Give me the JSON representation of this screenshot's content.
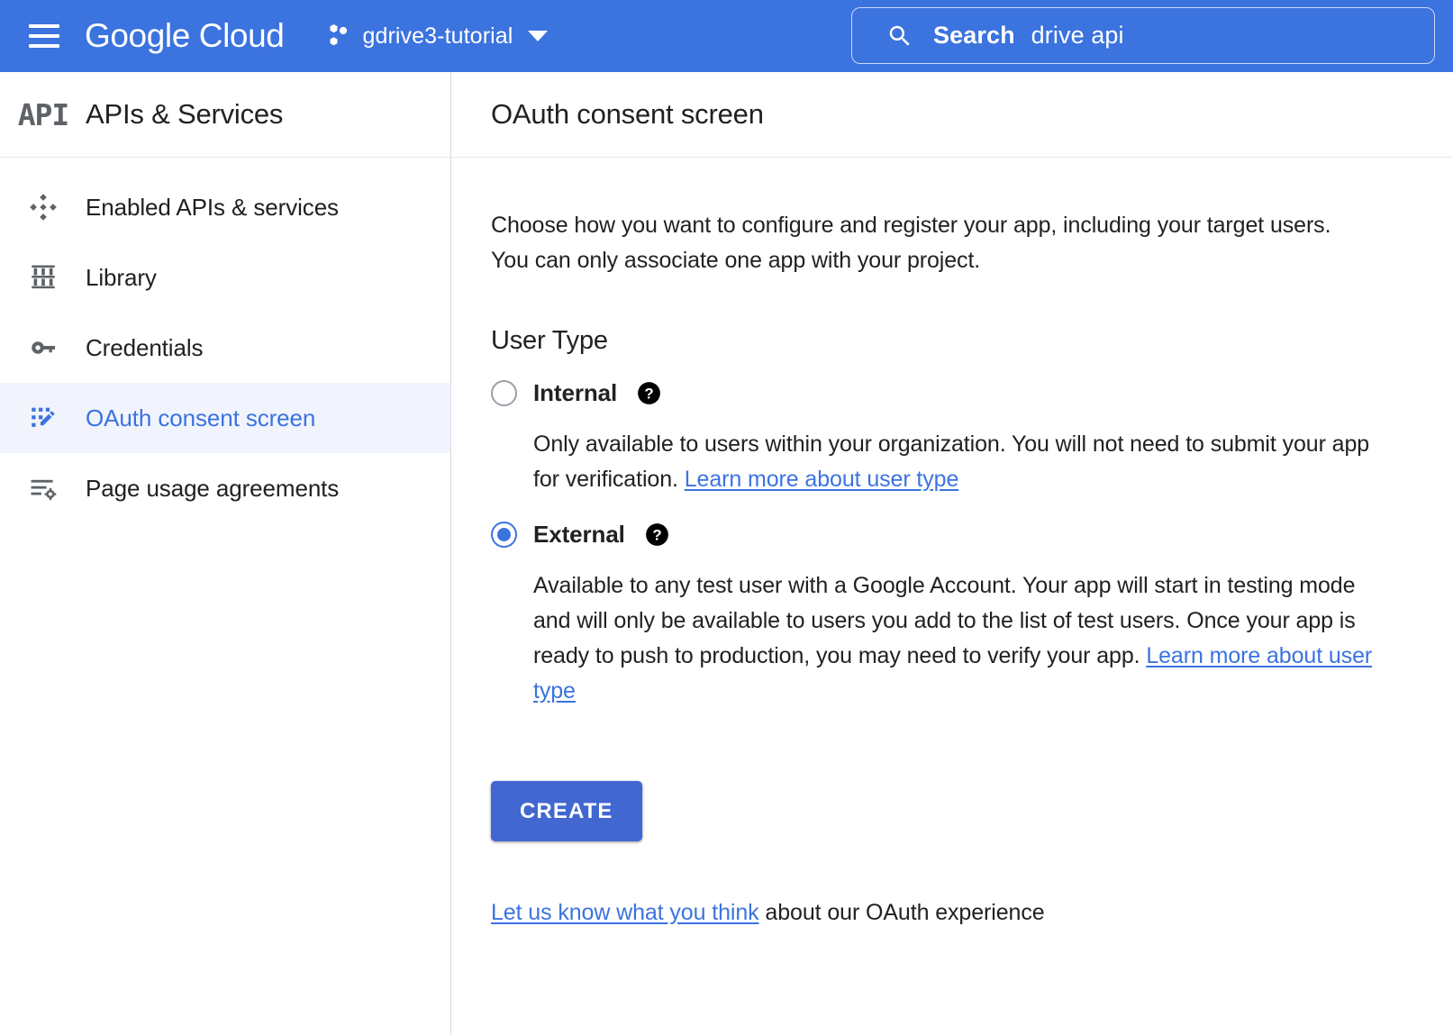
{
  "topbar": {
    "menu_icon": "hamburger-menu-icon",
    "brand": "Google Cloud",
    "project_icon": "cloud-project-icon",
    "project_name": "gdrive3-tutorial",
    "project_caret_icon": "chevron-down-icon",
    "search": {
      "icon": "search-icon",
      "label": "Search",
      "value": "drive api",
      "placeholder": "Search"
    },
    "background_color": "#3B73DF"
  },
  "sidebar": {
    "logo_text": "API",
    "title": "APIs & Services",
    "items": [
      {
        "label": "Enabled APIs & services",
        "icon": "dashboard-diamond-icon",
        "selected": false
      },
      {
        "label": "Library",
        "icon": "library-icon",
        "selected": false
      },
      {
        "label": "Credentials",
        "icon": "key-icon",
        "selected": false
      },
      {
        "label": "OAuth consent screen",
        "icon": "consent-screen-edit-icon",
        "selected": true
      },
      {
        "label": "Page usage agreements",
        "icon": "page-usage-agreements-icon",
        "selected": false
      }
    ],
    "selected_background": "#F1F4FD",
    "selected_text_color": "#3B73DF"
  },
  "main": {
    "page_title": "OAuth consent screen",
    "intro": "Choose how you want to configure and register your app, including your target users. You can only associate one app with your project.",
    "user_type_heading": "User Type",
    "options": [
      {
        "id": "internal",
        "label": "Internal",
        "selected": false,
        "help_icon": "help-circle-icon",
        "description_before_link": "Only available to users within your organization. You will not need to submit your app for verification. ",
        "link_text": "Learn more about user type",
        "description_after_link": ""
      },
      {
        "id": "external",
        "label": "External",
        "selected": true,
        "help_icon": "help-circle-icon",
        "description_before_link": "Available to any test user with a Google Account. Your app will start in testing mode and will only be available to users you add to the list of test users. Once your app is ready to push to production, you may need to verify your app. ",
        "link_text": "Learn more about user type",
        "description_after_link": ""
      }
    ],
    "create_button_label": "CREATE",
    "create_button_color": "#4267D0",
    "feedback": {
      "link_text": "Let us know what you think",
      "trailing_text": " about our OAuth experience"
    }
  }
}
